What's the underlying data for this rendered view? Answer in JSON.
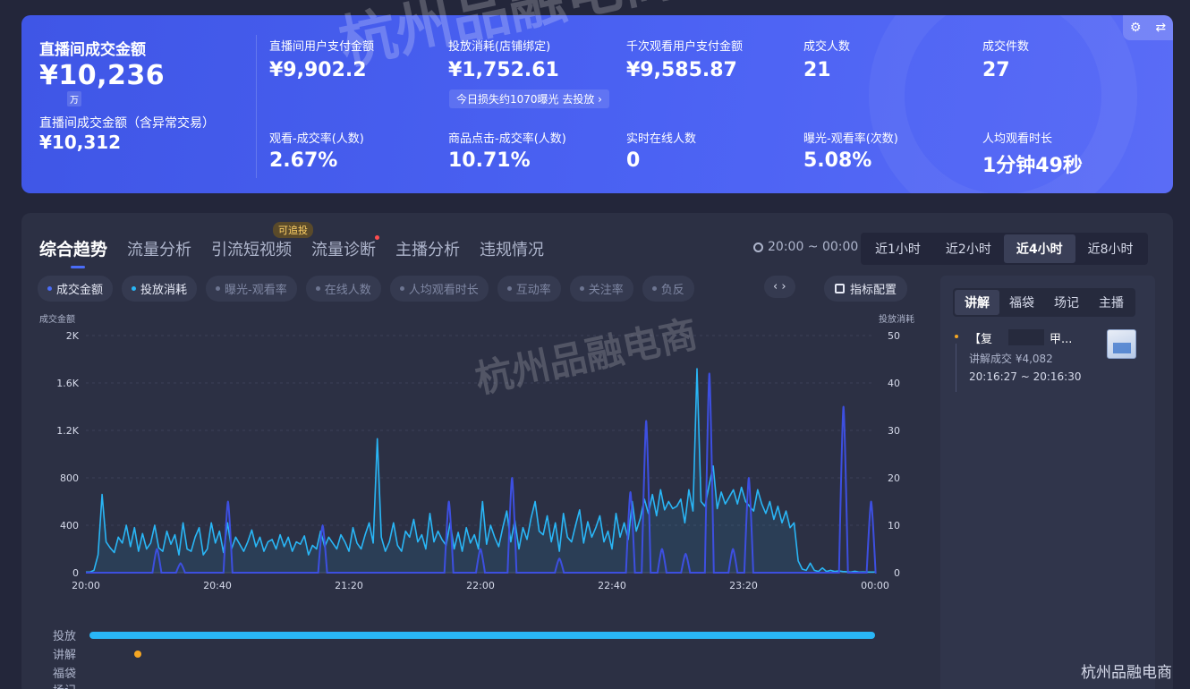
{
  "banner": {
    "main_title": "直播间成交金额",
    "main_value": "¥10,236",
    "main_unit": "万",
    "sub_title": "直播间成交金额（含异常交易）",
    "sub_value": "¥10,312",
    "loss_text": "今日损失约1070曝光  去投放 ›",
    "metrics": [
      {
        "label": "直播间用户支付金额",
        "value": "¥9,902.2"
      },
      {
        "label": "投放消耗(店铺绑定)",
        "value": "¥1,752.61"
      },
      {
        "label": "千次观看用户支付金额",
        "value": "¥9,585.87"
      },
      {
        "label": "成交人数",
        "value": "21"
      },
      {
        "label": "成交件数",
        "value": "27"
      },
      {
        "label": "观看-成交率(人数)",
        "value": "2.67%"
      },
      {
        "label": "商品点击-成交率(人数)",
        "value": "10.71%"
      },
      {
        "label": "实时在线人数",
        "value": "0"
      },
      {
        "label": "曝光-观看率(次数)",
        "value": "5.08%"
      },
      {
        "label": "人均观看时长",
        "value": "1分钟49秒"
      }
    ],
    "tool_icons": [
      "gear-icon",
      "swap-icon"
    ]
  },
  "tabs": [
    "综合趋势",
    "流量分析",
    "引流短视频",
    "流量诊断",
    "主播分析",
    "违规情况"
  ],
  "badge": "可追投",
  "time_range": "20:00 ~ 00:00",
  "ranges": [
    "近1小时",
    "近2小时",
    "近4小时",
    "近8小时"
  ],
  "chips": [
    "成交金额",
    "投放消耗",
    "曝光-观看率",
    "在线人数",
    "人均观看时长",
    "互动率",
    "关注率",
    "负反"
  ],
  "chip_nav": "‹  ›",
  "metric_config": "指标配置",
  "timeline_labels": [
    "投放",
    "讲解",
    "福袋",
    "场记"
  ],
  "side": {
    "tabs": [
      "讲解",
      "福袋",
      "场记",
      "主播"
    ],
    "item_title_a": "【复",
    "item_title_b": "甲...",
    "item_deal": "讲解成交 ¥4,082",
    "item_time": "20:16:27 ~ 20:16:30"
  },
  "watermarks": {
    "big": "杭州品融电商",
    "corner": "杭州品融电商"
  },
  "colors": {
    "banner": "#4b62f3",
    "line_gmv": "#29b6f6",
    "line_ads": "#3d4fe0",
    "accent": "#4a6cf7"
  },
  "chart_data": {
    "type": "line",
    "ylabel_left": "成交金额",
    "ylabel_right": "投放消耗",
    "ylim_left": [
      0,
      2000
    ],
    "ylim_right": [
      0,
      50
    ],
    "yticks_left": [
      "0",
      "400",
      "800",
      "1.2K",
      "1.6K",
      "2K"
    ],
    "yticks_right": [
      "0",
      "10",
      "20",
      "30",
      "40",
      "50"
    ],
    "xticks": [
      "20:00",
      "20:40",
      "21:20",
      "22:00",
      "22:40",
      "23:20",
      "00:00"
    ],
    "grid": true,
    "series": [
      {
        "name": "成交金额",
        "axis": "left",
        "minutes_span": 240,
        "values": [
          5,
          5,
          20,
          150,
          660,
          260,
          210,
          170,
          300,
          250,
          400,
          220,
          380,
          180,
          330,
          200,
          250,
          400,
          210,
          180,
          350,
          240,
          320,
          150,
          420,
          200,
          180,
          300,
          380,
          150,
          200,
          420,
          250,
          350,
          170,
          420,
          200,
          300,
          240,
          180,
          260,
          360,
          220,
          300,
          180,
          260,
          280,
          200,
          320,
          220,
          300,
          180,
          260,
          240,
          310,
          150,
          230,
          200,
          350,
          220,
          300,
          250,
          200,
          320,
          260,
          180,
          380,
          250,
          200,
          320,
          420,
          250,
          1130,
          300,
          180,
          260,
          420,
          230,
          180,
          350,
          300,
          450,
          260,
          320,
          200,
          500,
          260,
          350,
          280,
          230,
          420,
          200,
          340,
          180,
          380,
          250,
          320,
          200,
          600,
          240,
          400,
          300,
          220,
          380,
          520,
          260,
          440,
          200,
          380,
          280,
          460,
          600,
          350,
          320,
          480,
          260,
          420,
          180,
          500,
          300,
          260,
          400,
          530,
          250,
          430,
          300,
          380,
          480,
          260,
          350,
          200,
          500,
          300,
          420,
          280,
          600,
          350,
          460,
          620,
          500,
          660,
          480,
          700,
          530,
          600,
          540,
          560,
          620,
          420,
          700,
          520,
          1720,
          600,
          560,
          740,
          900,
          540,
          680,
          580,
          640,
          700,
          580,
          720,
          600,
          560,
          520,
          700,
          580,
          500,
          600,
          450,
          560,
          420,
          520,
          380,
          420,
          100,
          30,
          20,
          80,
          20,
          10,
          40,
          10,
          20,
          10,
          15,
          10,
          8,
          5,
          12,
          5,
          6,
          5,
          5,
          5
        ]
      },
      {
        "name": "投放消耗",
        "axis": "right",
        "minutes_span": 240,
        "values": [
          0,
          0,
          0,
          0,
          0,
          0,
          0,
          0,
          0,
          0,
          0,
          0,
          0,
          0,
          0,
          0,
          0,
          0,
          0,
          5,
          0,
          0,
          2,
          0,
          0,
          0,
          0,
          0,
          0,
          0,
          0,
          0,
          0,
          0,
          0,
          0,
          0,
          0,
          15,
          0,
          0,
          0,
          0,
          0,
          0,
          0,
          0,
          0,
          0,
          0,
          0,
          0,
          0,
          0,
          0,
          0,
          0,
          0,
          0,
          0,
          0,
          0,
          0,
          0,
          0,
          0,
          0,
          0,
          0,
          0,
          0,
          0,
          10,
          0,
          0,
          0,
          0,
          0,
          0,
          0,
          0,
          0,
          0,
          0,
          0,
          0,
          0,
          0,
          0,
          0,
          0,
          0,
          0,
          0,
          0,
          0,
          0,
          0,
          0,
          0,
          0,
          0,
          0,
          0,
          0,
          0,
          0,
          0,
          0,
          0,
          0,
          0,
          0,
          0,
          0,
          0,
          0,
          0,
          0,
          0,
          0,
          0,
          0,
          0,
          0,
          0,
          0,
          0,
          0,
          0,
          0,
          0,
          0,
          0,
          0,
          0,
          0,
          0,
          0,
          0,
          0,
          0,
          0,
          0,
          0,
          0,
          0,
          0,
          0,
          0,
          0,
          0,
          0,
          0,
          0,
          0,
          0,
          0,
          0,
          0,
          0,
          0,
          0,
          0,
          0,
          0,
          0,
          0,
          0,
          0,
          0,
          0,
          0,
          0,
          0,
          0,
          0,
          0,
          0,
          0,
          0,
          0,
          0,
          0,
          0,
          0,
          0,
          0,
          0,
          0,
          0,
          0,
          0,
          0,
          0,
          0,
          0,
          0,
          0,
          0,
          0,
          0,
          0,
          0,
          0
        ]
      }
    ]
  }
}
